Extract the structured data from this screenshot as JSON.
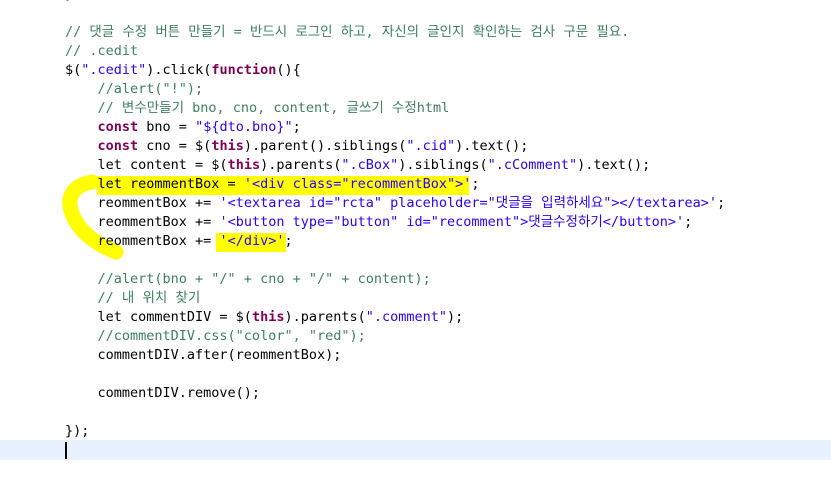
{
  "editor": {
    "lines": [
      {
        "segs": [
          {
            "t": "});",
            "c": ""
          }
        ]
      },
      {
        "segs": []
      },
      {
        "segs": [
          {
            "t": "// 댓글 수정 버튼 만들기 = 반드시 로그인 하고, 자신의 글인지 확인하는 검사 구문 필요.",
            "c": "c"
          }
        ]
      },
      {
        "segs": [
          {
            "t": "// .cedit",
            "c": "c"
          }
        ]
      },
      {
        "segs": [
          {
            "t": "$(",
            "c": ""
          },
          {
            "t": "\".cedit\"",
            "c": "s"
          },
          {
            "t": ").click(",
            "c": ""
          },
          {
            "t": "function",
            "c": "k"
          },
          {
            "t": "(){",
            "c": ""
          }
        ]
      },
      {
        "segs": [
          {
            "t": "    //alert(\"!\");",
            "c": "c"
          }
        ]
      },
      {
        "segs": [
          {
            "t": "    // 변수만들기 bno, cno, content, 글쓰기 수정html",
            "c": "c"
          }
        ]
      },
      {
        "segs": [
          {
            "t": "    ",
            "c": ""
          },
          {
            "t": "const",
            "c": "k"
          },
          {
            "t": " bno = ",
            "c": ""
          },
          {
            "t": "\"${dto.bno}\"",
            "c": "s"
          },
          {
            "t": ";",
            "c": ""
          }
        ]
      },
      {
        "segs": [
          {
            "t": "    ",
            "c": ""
          },
          {
            "t": "const",
            "c": "k"
          },
          {
            "t": " cno = $(",
            "c": ""
          },
          {
            "t": "this",
            "c": "k"
          },
          {
            "t": ").parent().siblings(",
            "c": ""
          },
          {
            "t": "\".cid\"",
            "c": "s"
          },
          {
            "t": ").text();",
            "c": ""
          }
        ]
      },
      {
        "segs": [
          {
            "t": "    let content = $(",
            "c": ""
          },
          {
            "t": "this",
            "c": "k"
          },
          {
            "t": ").parents(",
            "c": ""
          },
          {
            "t": "\".cBox\"",
            "c": "s"
          },
          {
            "t": ").siblings(",
            "c": ""
          },
          {
            "t": "\".cComment\"",
            "c": "s"
          },
          {
            "t": ").text();",
            "c": ""
          }
        ]
      },
      {
        "segs": [
          {
            "t": "    let reommentBox = ",
            "c": ""
          },
          {
            "t": "'<div class=\"recommentBox\">'",
            "c": "s"
          },
          {
            "t": ";",
            "c": ""
          }
        ]
      },
      {
        "segs": [
          {
            "t": "    reommentBox += ",
            "c": ""
          },
          {
            "t": "'<textarea id=\"rcta\" placeholder=\"댓글을 입력하세요\"></textarea>'",
            "c": "s"
          },
          {
            "t": ";",
            "c": ""
          }
        ]
      },
      {
        "segs": [
          {
            "t": "    reommentBox += ",
            "c": ""
          },
          {
            "t": "'<button type=\"button\" id=\"recomment\">댓글수정하기</button>'",
            "c": "s"
          },
          {
            "t": ";",
            "c": ""
          }
        ]
      },
      {
        "segs": [
          {
            "t": "    reommentBox += ",
            "c": ""
          },
          {
            "t": "'</div>'",
            "c": "s"
          },
          {
            "t": ";",
            "c": ""
          }
        ]
      },
      {
        "segs": []
      },
      {
        "segs": [
          {
            "t": "    //alert(bno + \"/\" + cno + \"/\" + content);",
            "c": "c"
          }
        ]
      },
      {
        "segs": [
          {
            "t": "    // 내 위치 찾기",
            "c": "c"
          }
        ]
      },
      {
        "segs": [
          {
            "t": "    let commentDIV = $(",
            "c": ""
          },
          {
            "t": "this",
            "c": "k"
          },
          {
            "t": ").parents(",
            "c": ""
          },
          {
            "t": "\".comment\"",
            "c": "s"
          },
          {
            "t": ");",
            "c": ""
          }
        ]
      },
      {
        "segs": [
          {
            "t": "    //commentDIV.css(\"color\", \"red\");",
            "c": "c"
          }
        ]
      },
      {
        "segs": [
          {
            "t": "    commentDIV.after(reommentBox);",
            "c": ""
          }
        ]
      },
      {
        "segs": []
      },
      {
        "segs": [
          {
            "t": "    commentDIV.remove();",
            "c": ""
          }
        ]
      },
      {
        "segs": []
      },
      {
        "segs": [
          {
            "t": "});",
            "c": ""
          }
        ]
      },
      {
        "segs": []
      }
    ]
  },
  "colors": {
    "comment": "#3f7f5f",
    "keyword": "#7f0055",
    "string": "#2a00ff",
    "highlight": "#ffff00",
    "current_line": "#e8f2fe"
  }
}
